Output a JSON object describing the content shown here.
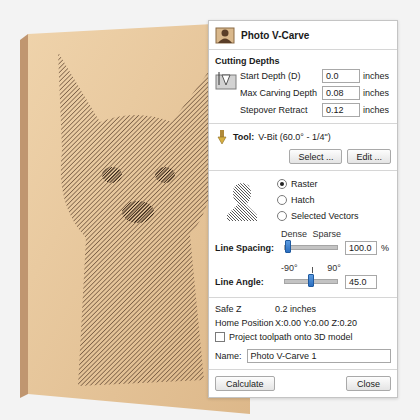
{
  "window": {
    "title": "Photo V-Carve"
  },
  "cutting_depths": {
    "title": "Cutting Depths",
    "fields": [
      {
        "label": "Start Depth (D)",
        "value": "0.0",
        "unit": "inches"
      },
      {
        "label": "Max Carving Depth",
        "value": "0.08",
        "unit": "inches"
      },
      {
        "label": "Stepover Retract",
        "value": "0.12",
        "unit": "inches"
      }
    ]
  },
  "tool": {
    "label": "Tool:",
    "name": "V-Bit (60.0° - 1/4\")",
    "buttons": [
      "Select ...",
      "Edit ..."
    ]
  },
  "strategy": {
    "options": [
      {
        "label": "Raster",
        "selected": true
      },
      {
        "label": "Hatch",
        "selected": false
      },
      {
        "label": "Selected Vectors",
        "selected": false
      }
    ]
  },
  "sliders": [
    {
      "label": "Line Spacing:",
      "min_label": "Dense",
      "max_label": "Sparse",
      "value": "100.0",
      "unit": "%",
      "level": 0.05
    },
    {
      "label": "Line Angle:",
      "min_label": "-90°",
      "max_label": "90°",
      "value": "45.0",
      "unit": "",
      "level": 0.5
    }
  ],
  "settings": [
    {
      "label": "Safe Z",
      "value": "0.2 inches"
    },
    {
      "label": "Home Position",
      "value": "X:0.00 Y:0.00 Z:0.20"
    }
  ],
  "project_toolpath": {
    "label": "Project toolpath onto 3D model",
    "checked": false
  },
  "name": {
    "label": "Name:",
    "value": "Photo V-Carve 1"
  },
  "buttons": [
    "Calculate",
    "Close"
  ]
}
